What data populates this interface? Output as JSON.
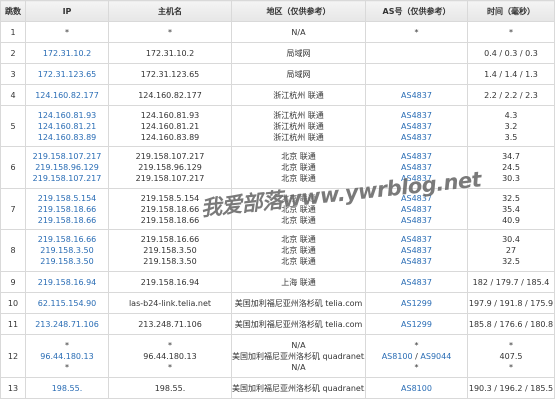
{
  "headers": {
    "hop": "跳数",
    "ip": "IP",
    "host": "主机名",
    "region": "地区（仅供参考）",
    "as": "AS号（仅供参考）",
    "time": "时间（毫秒）"
  },
  "rows": [
    {
      "hop": "1",
      "ip": [
        "*"
      ],
      "host": [
        "*"
      ],
      "region": [
        "N/A"
      ],
      "as": [
        "*"
      ],
      "time": "*"
    },
    {
      "hop": "2",
      "ip": [
        "172.31.10.2"
      ],
      "host": [
        "172.31.10.2"
      ],
      "region": [
        "局域网"
      ],
      "as": [],
      "time": "0.4 / 0.3 / 0.3"
    },
    {
      "hop": "3",
      "ip": [
        "172.31.123.65"
      ],
      "host": [
        "172.31.123.65"
      ],
      "region": [
        "局域网"
      ],
      "as": [],
      "time": "1.4 / 1.4 / 1.3"
    },
    {
      "hop": "4",
      "ip": [
        "124.160.82.177"
      ],
      "host": [
        "124.160.82.177"
      ],
      "region": [
        "浙江杭州 联通"
      ],
      "as": [
        "AS4837"
      ],
      "time": "2.2 / 2.2 / 2.3"
    },
    {
      "hop": "5",
      "ip": [
        "124.160.81.93",
        "124.160.81.21",
        "124.160.83.89"
      ],
      "host": [
        "124.160.81.93",
        "124.160.81.21",
        "124.160.83.89"
      ],
      "region": [
        "浙江杭州 联通",
        "浙江杭州 联通",
        "浙江杭州 联通"
      ],
      "as": [
        "AS4837",
        "AS4837",
        "AS4837"
      ],
      "time": "4.3\n3.2\n3.5"
    },
    {
      "hop": "6",
      "ip": [
        "219.158.107.217",
        "219.158.96.129",
        "219.158.107.217"
      ],
      "host": [
        "219.158.107.217",
        "219.158.96.129",
        "219.158.107.217"
      ],
      "region": [
        "北京 联通",
        "北京 联通",
        "北京 联通"
      ],
      "as": [
        "AS4837",
        "AS4837",
        "AS4837"
      ],
      "time": "34.7\n24.5\n30.3"
    },
    {
      "hop": "7",
      "ip": [
        "219.158.5.154",
        "219.158.18.66",
        "219.158.18.66"
      ],
      "host": [
        "219.158.5.154",
        "219.158.18.66",
        "219.158.18.66"
      ],
      "region": [
        "北京 联通",
        "北京 联通",
        "北京 联通"
      ],
      "as": [
        "AS4837",
        "AS4837",
        "AS4837"
      ],
      "time": "32.5\n35.4\n40.9"
    },
    {
      "hop": "8",
      "ip": [
        "219.158.16.66",
        "219.158.3.50",
        "219.158.3.50"
      ],
      "host": [
        "219.158.16.66",
        "219.158.3.50",
        "219.158.3.50"
      ],
      "region": [
        "北京 联通",
        "北京 联通",
        "北京 联通"
      ],
      "as": [
        "AS4837",
        "AS4837",
        "AS4837"
      ],
      "time": "30.4\n27\n32.5"
    },
    {
      "hop": "9",
      "ip": [
        "219.158.16.94"
      ],
      "host": [
        "219.158.16.94"
      ],
      "region": [
        "上海 联通"
      ],
      "as": [
        "AS4837"
      ],
      "time": "182 / 179.7 / 185.4"
    },
    {
      "hop": "10",
      "ip": [
        "62.115.154.90"
      ],
      "host": [
        "las-b24-link.telia.net"
      ],
      "region": [
        "美国加利福尼亚州洛杉矶 telia.com"
      ],
      "as": [
        "AS1299"
      ],
      "time": "197.9 / 191.8 / 175.9"
    },
    {
      "hop": "11",
      "ip": [
        "213.248.71.106"
      ],
      "host": [
        "213.248.71.106"
      ],
      "region": [
        "美国加利福尼亚州洛杉矶 telia.com"
      ],
      "as": [
        "AS1299"
      ],
      "time": "185.8 / 176.6 / 180.8"
    },
    {
      "hop": "12",
      "ip": [
        "*",
        "96.44.180.13",
        "*"
      ],
      "host": [
        "*",
        "96.44.180.13",
        "*"
      ],
      "region": [
        "N/A",
        "美国加利福尼亚州洛杉矶 quadranet.com",
        "N/A"
      ],
      "as": [
        "*",
        "AS8100 / AS9044",
        "*"
      ],
      "time": "*\n407.5\n*"
    },
    {
      "hop": "13",
      "ip": [
        "198.55."
      ],
      "host": [
        "198.55."
      ],
      "region": [
        "美国加利福尼亚州洛杉矶 quadranet.com"
      ],
      "as": [
        "AS8100"
      ],
      "time": "190.3 / 196.2 / 185.5"
    }
  ],
  "watermark": "我爱部落www.ywrblog.net",
  "colors": {
    "link": "#2a6db5",
    "border": "#d9d9d9",
    "header_bg": "#ececec"
  }
}
